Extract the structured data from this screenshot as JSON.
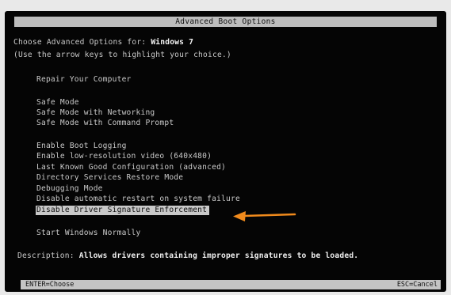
{
  "window": {
    "title": "Advanced Boot Options"
  },
  "header": {
    "choose_prefix": "Choose Advanced Options for: ",
    "os_name": "Windows 7",
    "hint": "(Use the arrow keys to highlight your choice.)"
  },
  "menu": {
    "items": [
      {
        "label": "Repair Your Computer"
      },
      {
        "label": "Safe Mode"
      },
      {
        "label": "Safe Mode with Networking"
      },
      {
        "label": "Safe Mode with Command Prompt"
      },
      {
        "label": "Enable Boot Logging"
      },
      {
        "label": "Enable low-resolution video (640x480)"
      },
      {
        "label": "Last Known Good Configuration (advanced)"
      },
      {
        "label": "Directory Services Restore Mode"
      },
      {
        "label": "Debugging Mode"
      },
      {
        "label": "Disable automatic restart on system failure"
      },
      {
        "label": "Disable Driver Signature Enforcement",
        "selected": true
      },
      {
        "label": "Start Windows Normally"
      }
    ]
  },
  "description": {
    "label": "Description: ",
    "text": "Allows drivers containing improper signatures to be loaded."
  },
  "footer": {
    "left": "ENTER=Choose",
    "right": "ESC=Cancel"
  },
  "colors": {
    "background": "#050505",
    "text": "#c9c9c9",
    "highlight": "#c9c9c9",
    "arrow": "#f08a1c"
  },
  "annotation": {
    "icon": "arrow-left-icon"
  }
}
